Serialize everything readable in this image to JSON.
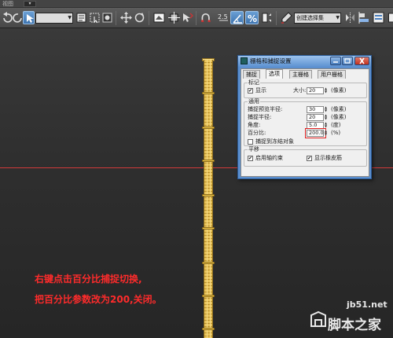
{
  "menubar": {
    "label": "视图",
    "mini_label": "▾"
  },
  "toolbar": {
    "selection_filter": "",
    "selection_set": "创建选择集",
    "snap_value": "2.5"
  },
  "dialog": {
    "title": "栅格和捕捉设置",
    "tabs": [
      "捕捉",
      "选项",
      "主栅格",
      "用户栅格"
    ],
    "active_tab": 1,
    "marker": {
      "group_title": "标记",
      "display_label": "显示",
      "display_checked": true,
      "size_label": "大小:",
      "size_value": "20",
      "size_unit": "(像素)"
    },
    "general": {
      "group_title": "通用",
      "preview_radius_label": "捕捉预览半径:",
      "preview_radius_value": "30",
      "preview_radius_unit": "(像素)",
      "snap_radius_label": "捕捉半径:",
      "snap_radius_value": "20",
      "snap_radius_unit": "(像素)",
      "angle_label": "角度:",
      "angle_value": "5.0",
      "angle_unit": "(度)",
      "percent_label": "百分比:",
      "percent_value": "200.0",
      "percent_unit": "(%)",
      "frozen_label": "捕捉到冻结对象",
      "frozen_checked": false
    },
    "translate": {
      "group_title": "平移",
      "axis_constraint_label": "启用轴约束",
      "axis_constraint_checked": true,
      "rubberband_label": "显示橡皮筋",
      "rubberband_checked": true
    }
  },
  "instructions": {
    "line1": "右键点击百分比捕捉切换,",
    "line2": "把百分比参数改为200,关闭。"
  },
  "watermark": {
    "url": "jb51.net",
    "name": "脚本之家"
  },
  "colors": {
    "accent": "#5b8fcf",
    "instruction_text": "#ff2b2b",
    "highlight": "#e02020",
    "guide_line": "#d23a3a"
  }
}
